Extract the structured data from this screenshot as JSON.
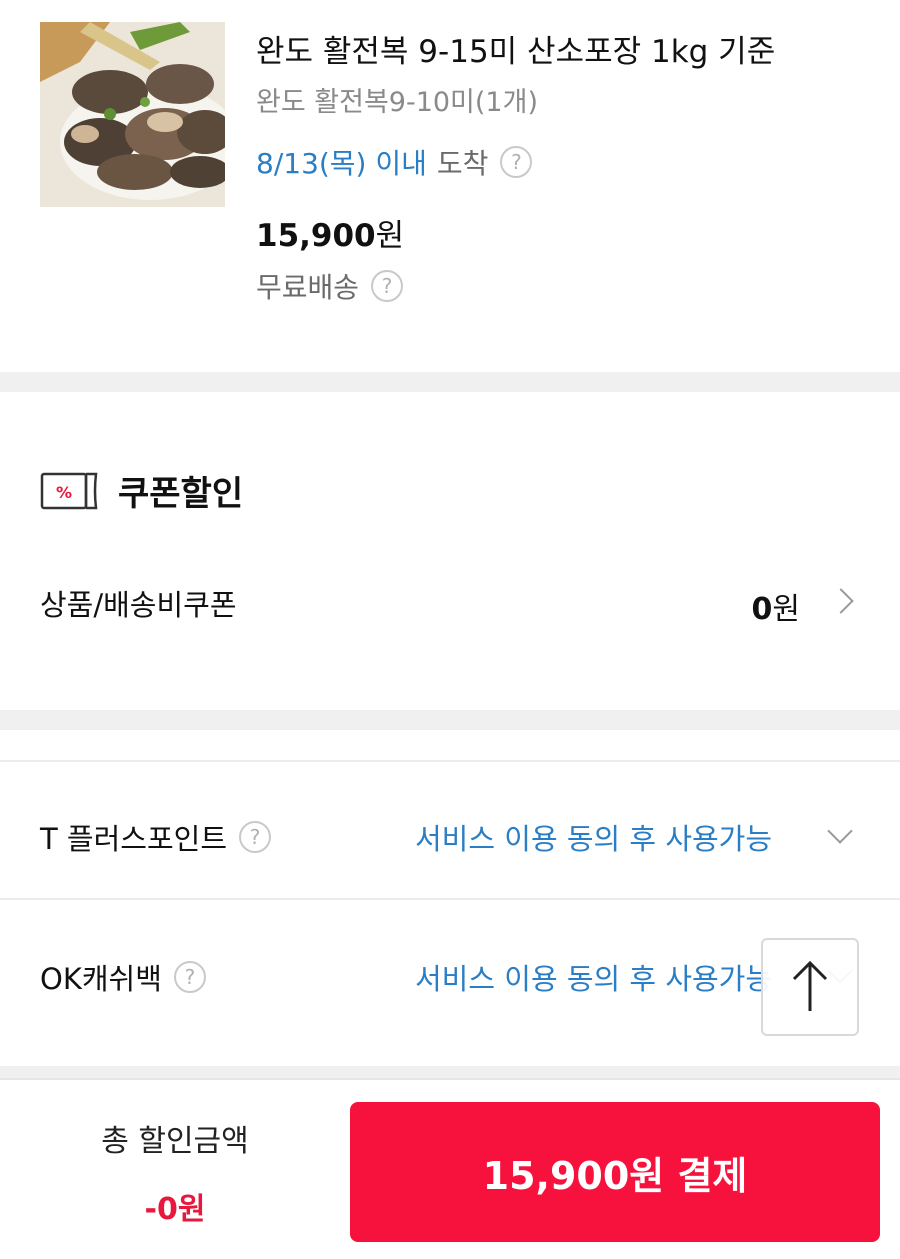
{
  "product": {
    "title": "완도 활전복 9-15미 산소포장 1kg 기준",
    "option": "완도 활전복9-10미(1개)",
    "delivery_date": "8/13(목) 이내",
    "delivery_label": "도착",
    "price_number": "15,900",
    "price_unit": "원",
    "shipping": "무료배송",
    "help_glyph": "?"
  },
  "coupon": {
    "title": "쿠폰할인",
    "icon_text": "%",
    "row_label": "상품/배송비쿠폰",
    "value_number": "0",
    "value_unit": "원"
  },
  "points": {
    "tplus_label": "T 플러스포인트",
    "tplus_status": "서비스 이용 동의 후 사용가능",
    "okcashbag_label": "OK캐쉬백",
    "okcashbag_status": "서비스 이용 동의 후 사용가능"
  },
  "footer": {
    "total_label": "총 할인금액",
    "total_value": "-0원",
    "pay_label": "15,900원 결제"
  },
  "colors": {
    "accent_blue": "#2a7ec6",
    "pay_red": "#f7123d",
    "discount_red": "#e8183c"
  },
  "icons": [
    "help-circle-icon",
    "coupon-icon",
    "chevron-right-icon",
    "chevron-down-icon",
    "arrow-up-icon"
  ]
}
